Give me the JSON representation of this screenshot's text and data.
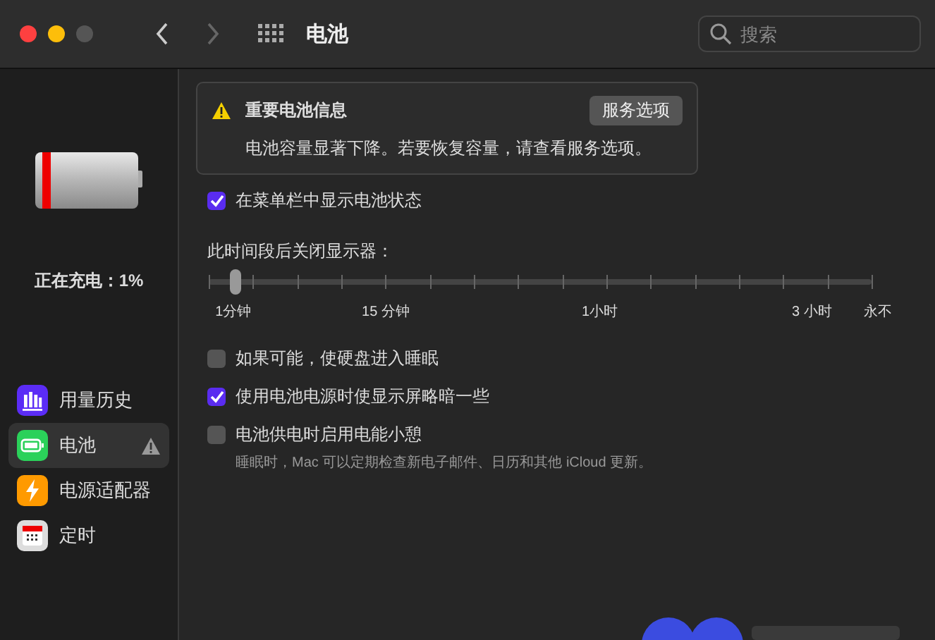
{
  "window": {
    "title": "电池"
  },
  "toolbar": {
    "search": {
      "placeholder": "搜索"
    }
  },
  "sidebar": {
    "status": "正在充电：1%",
    "items": [
      {
        "label": "用量历史",
        "kind": "history",
        "selected": false,
        "warning": false
      },
      {
        "label": "电池",
        "kind": "battery",
        "selected": true,
        "warning": true
      },
      {
        "label": "电源适配器",
        "kind": "power",
        "selected": false,
        "warning": false
      },
      {
        "label": "定时",
        "kind": "schedule",
        "selected": false,
        "warning": false
      }
    ]
  },
  "notice": {
    "title": "重要电池信息",
    "button": "服务选项",
    "message": "电池容量显著下降。若要恢复容量，请查看服务选项。"
  },
  "menu_bar_checkbox": {
    "label": "在菜单栏中显示电池状态",
    "checked": true
  },
  "display_off": {
    "label": "此时间段后关闭显示器：",
    "level": 0.04,
    "ticks": [
      "1分钟",
      "15 分钟",
      "1小时",
      "3 小时",
      "永不"
    ]
  },
  "options": [
    {
      "label": "如果可能，使硬盘进入睡眠",
      "checked": false
    },
    {
      "label": "使用电池电源时使显示屏略暗一些",
      "checked": true
    },
    {
      "label": "电池供电时启用电能小憩",
      "checked": false,
      "note": "睡眠时，Mac 可以定期检查新电子邮件、日历和其他 iCloud 更新。"
    }
  ]
}
